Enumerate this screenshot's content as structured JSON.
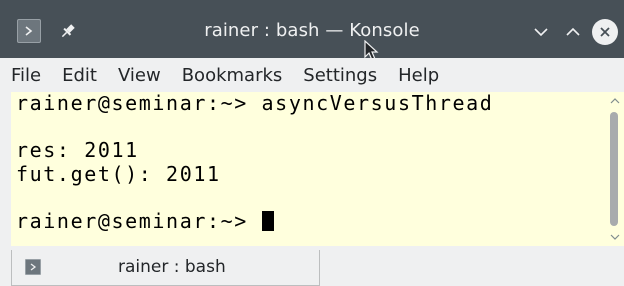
{
  "window": {
    "title": "rainer : bash — Konsole"
  },
  "titlebar_icons": {
    "app": "konsole-icon",
    "pin": "pin-icon",
    "minimize": "chevron-down-icon",
    "maximize": "chevron-up-icon",
    "close": "close-icon"
  },
  "menu": {
    "items": [
      "File",
      "Edit",
      "View",
      "Bookmarks",
      "Settings",
      "Help"
    ]
  },
  "terminal": {
    "lines": [
      "rainer@seminar:~> asyncVersusThread",
      "",
      "res: 2011",
      "fut.get(): 2011",
      "",
      "rainer@seminar:~> "
    ],
    "background": "#ffffdd",
    "foreground": "#000000"
  },
  "tabs": [
    {
      "label": "rainer : bash"
    }
  ],
  "colors": {
    "titlebar": "#475057",
    "chrome": "#eff0f1"
  }
}
